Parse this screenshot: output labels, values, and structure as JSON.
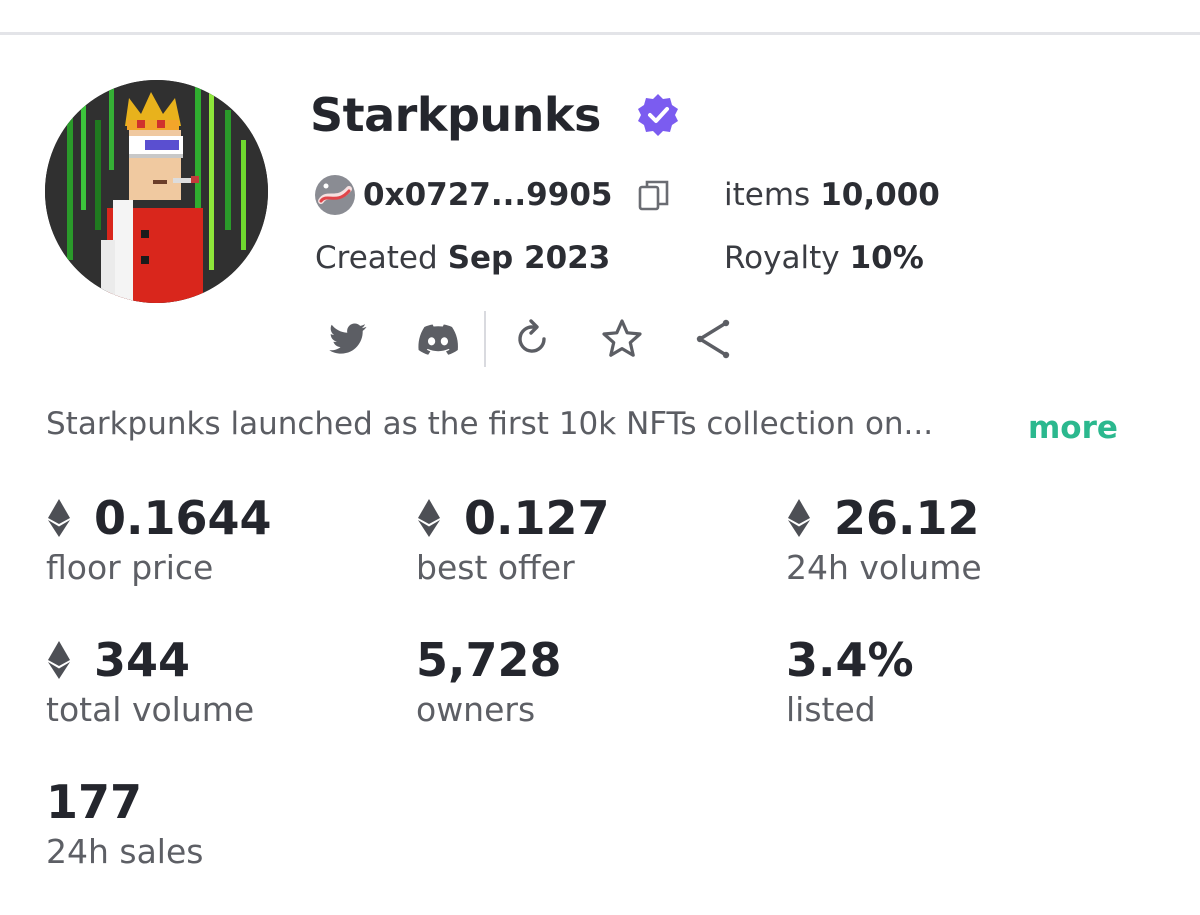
{
  "collection": {
    "name": "Starkpunks",
    "verified_icon": "verified-badge-icon",
    "address": "0x0727...9905",
    "created_label": "Created",
    "created_value": "Sep 2023",
    "items_label": "items",
    "items_value": "10,000",
    "royalty_label": "Royalty",
    "royalty_value": "10%",
    "description": "Starkpunks launched as the first 10k NFTs collection on...",
    "more_label": "more"
  },
  "actions": [
    {
      "name": "twitter-icon"
    },
    {
      "name": "discord-icon"
    },
    {
      "name": "refresh-icon"
    },
    {
      "name": "star-icon"
    },
    {
      "name": "share-icon"
    }
  ],
  "stats": [
    {
      "value": "0.1644",
      "label": "floor price",
      "eth": true
    },
    {
      "value": "0.127",
      "label": "best offer",
      "eth": true
    },
    {
      "value": "26.12",
      "label": "24h volume",
      "eth": true
    },
    {
      "value": "344",
      "label": "total volume",
      "eth": true
    },
    {
      "value": "5,728",
      "label": "owners",
      "eth": false
    },
    {
      "value": "3.4%",
      "label": "listed",
      "eth": false
    },
    {
      "value": "177",
      "label": "24h sales",
      "eth": false
    }
  ],
  "colors": {
    "accent_green": "#2bb88e",
    "verified_purple": "#7b5cf0",
    "text_dark": "#24262d",
    "text_muted": "#5d5f65"
  }
}
